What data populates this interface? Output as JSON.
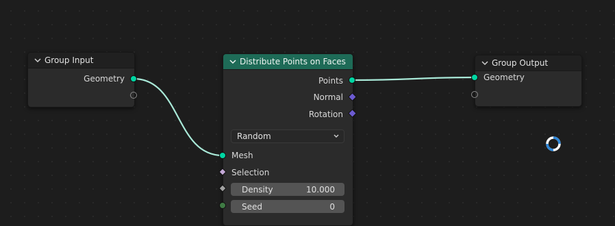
{
  "nodes": {
    "group_input": {
      "title": "Group Input",
      "outputs": [
        "Geometry"
      ]
    },
    "distribute": {
      "title": "Distribute Points on Faces",
      "outputs": [
        "Points",
        "Normal",
        "Rotation"
      ],
      "mode": "Random",
      "inputs": {
        "mesh": "Mesh",
        "selection": "Selection",
        "density_label": "Density",
        "density_value": "10.000",
        "seed_label": "Seed",
        "seed_value": "0"
      }
    },
    "group_output": {
      "title": "Group Output",
      "inputs": [
        "Geometry"
      ]
    }
  },
  "colors": {
    "geometry_socket": "#00d6a3",
    "vector_socket": "#6c5bd1",
    "boolean_socket": "#c4a9d6",
    "float_socket": "#a1a1a1",
    "integer_socket": "#3f7a44",
    "distribute_header": "#1e6b57",
    "link": "#5fd0b4"
  },
  "icons": {
    "collapse": "chevron-down-icon",
    "dropdown": "chevron-down-icon",
    "loading": "spinner-icon"
  }
}
